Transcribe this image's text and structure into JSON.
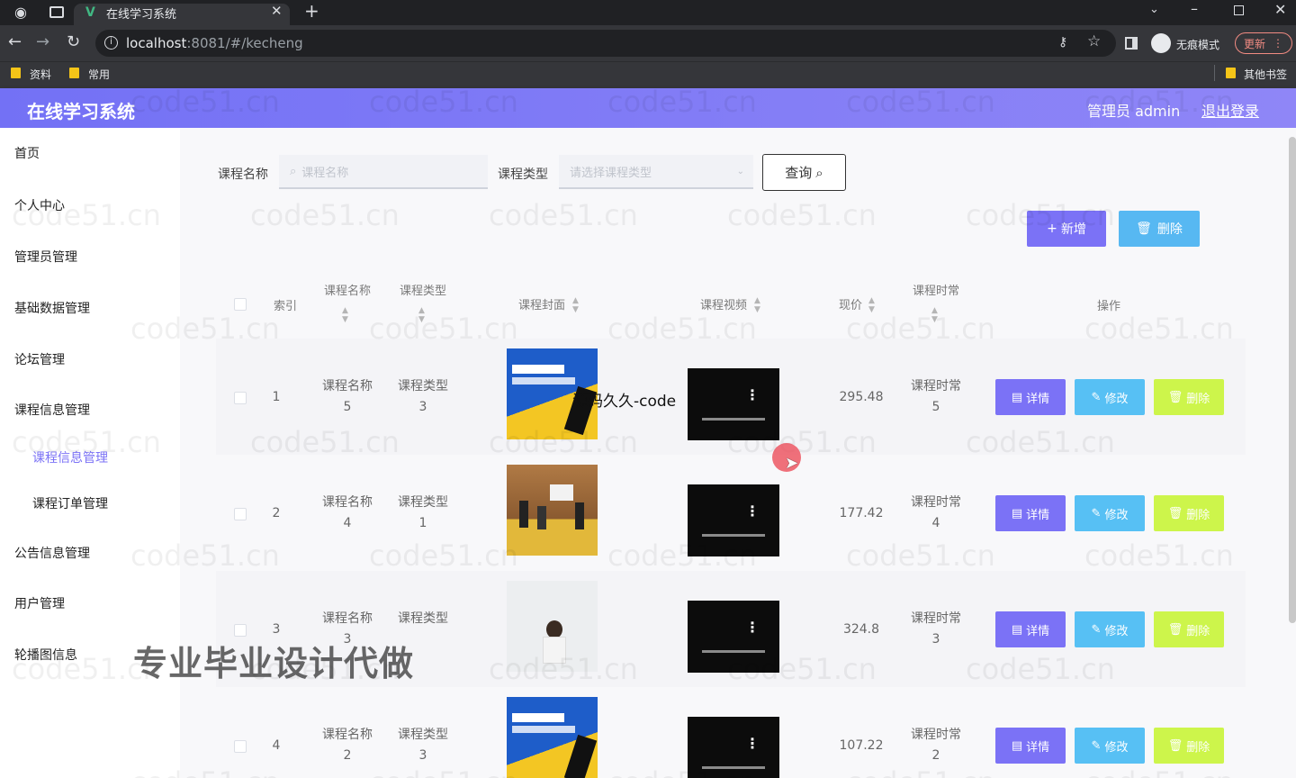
{
  "browser": {
    "tab_title": "在线学习系统",
    "url_host": "localhost",
    "url_rest": ":8081/#/kecheng",
    "incognito_label": "无痕模式",
    "update_label": "更新",
    "bookmarks": [
      "资料",
      "常用"
    ],
    "other_bookmarks": "其他书签"
  },
  "header": {
    "title": "在线学习系统",
    "admin_label": "管理员 admin",
    "logout_label": "退出登录"
  },
  "sidebar": {
    "items": [
      {
        "label": "首页"
      },
      {
        "label": "个人中心"
      },
      {
        "label": "管理员管理"
      },
      {
        "label": "基础数据管理"
      },
      {
        "label": "论坛管理"
      },
      {
        "label": "课程信息管理"
      },
      {
        "label": "公告信息管理"
      },
      {
        "label": "用户管理"
      },
      {
        "label": "轮播图信息"
      }
    ],
    "subitems": [
      {
        "label": "课程信息管理",
        "active": true
      },
      {
        "label": "课程订单管理",
        "active": false
      }
    ],
    "active_color": "#7b72f6"
  },
  "search": {
    "name_label": "课程名称",
    "name_placeholder": "课程名称",
    "type_label": "课程类型",
    "type_placeholder": "请选择课程类型",
    "query_label": "查询"
  },
  "actions": {
    "add_label": "新增",
    "delete_label": "删除"
  },
  "table": {
    "headers": {
      "index": "索引",
      "name": "课程名称",
      "type": "课程类型",
      "cover": "课程封面",
      "video": "课程视频",
      "price": "现价",
      "duration": "课程时常",
      "ops": "操作"
    },
    "row_actions": {
      "detail": "详情",
      "edit": "修改",
      "delete": "删除"
    },
    "rows": [
      {
        "index": "1",
        "name": "课程名称",
        "name_num": "5",
        "type": "课程类型",
        "type_num": "3",
        "price": "295.48",
        "duration": "课程时常",
        "duration_num": "5",
        "cover": "book"
      },
      {
        "index": "2",
        "name": "课程名称",
        "name_num": "4",
        "type": "课程类型",
        "type_num": "1",
        "price": "177.42",
        "duration": "课程时常",
        "duration_num": "4",
        "cover": "classroom"
      },
      {
        "index": "3",
        "name": "课程名称",
        "name_num": "3",
        "type": "课程类型",
        "type_num": "",
        "price": "324.8",
        "duration": "课程时常",
        "duration_num": "3",
        "cover": "person"
      },
      {
        "index": "4",
        "name": "课程名称",
        "name_num": "2",
        "type": "课程类型",
        "type_num": "3",
        "price": "107.22",
        "duration": "课程时常",
        "duration_num": "2",
        "cover": "book"
      }
    ]
  },
  "overlays": {
    "watermark": "code51.cn",
    "promo": "专业毕业设计代做",
    "caption": "源码久久-code"
  },
  "colors": {
    "header_bg": "#7b72f6",
    "btn_detail": "#7b72f6",
    "btn_edit": "#57c0f4",
    "btn_delete": "#cdf54b"
  }
}
